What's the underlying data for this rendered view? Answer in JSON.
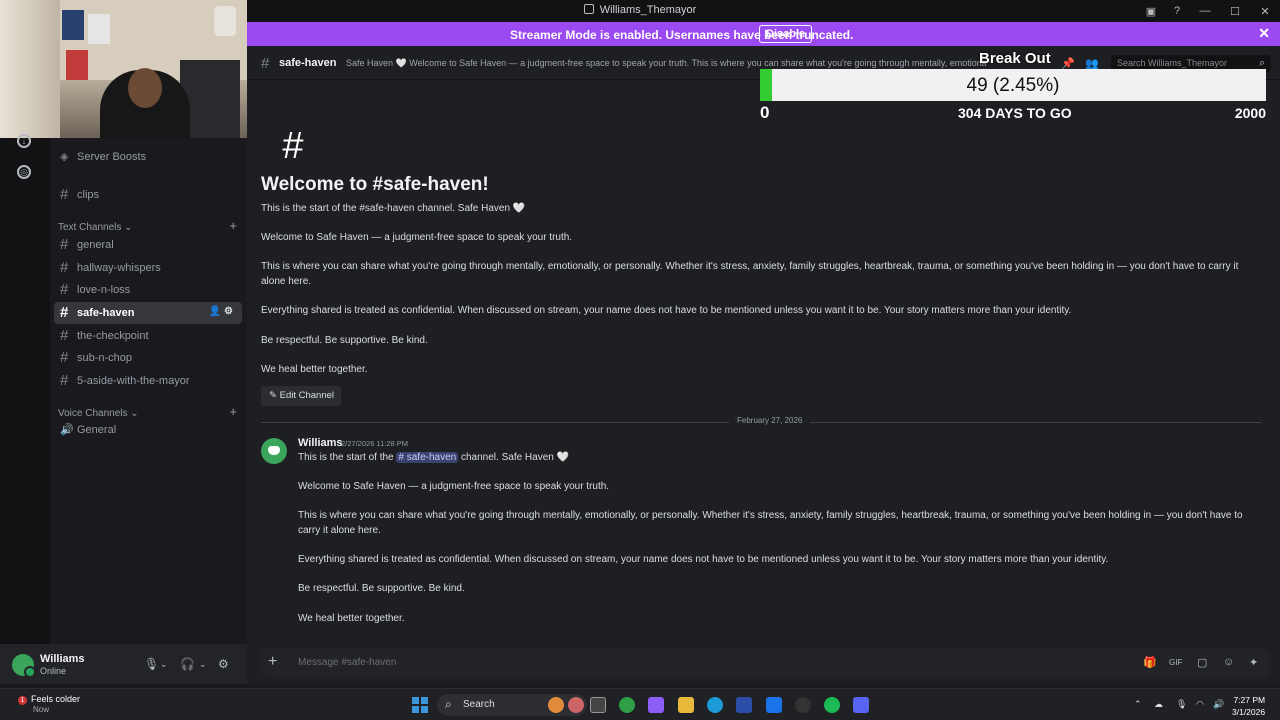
{
  "window": {
    "title": "Williams_Themayor"
  },
  "streamer_banner": {
    "text": "Streamer Mode is enabled. Usernames have been truncated.",
    "disable_label": "Disable",
    "close_icon": "close-icon",
    "color": "#9b49f1"
  },
  "sidebar": {
    "server_boosts": "Server Boosts",
    "top_items": [
      {
        "label": "clips"
      }
    ],
    "text_category": "Text Channels",
    "text_channels": [
      {
        "label": "general"
      },
      {
        "label": "hallway-whispers"
      },
      {
        "label": "love-n-loss"
      },
      {
        "label": "safe-haven",
        "active": true
      },
      {
        "label": "the-checkpoint"
      },
      {
        "label": "sub-n-chop"
      },
      {
        "label": "5-aside-with-the-mayor"
      }
    ],
    "voice_category": "Voice Channels",
    "voice_channels": [
      {
        "label": "General"
      }
    ]
  },
  "user": {
    "name": "Williams",
    "status": "Online"
  },
  "channel": {
    "name": "safe-haven",
    "topic": "Safe Haven 🤍 Welcome to Safe Haven — a judgment-free space to speak your truth. This is where you can share what you're going through mentally, emotionally,",
    "search_placeholder": "Search Williams_Themayor"
  },
  "overlay": {
    "title": "Break Out",
    "current_label": "49 (2.45%)",
    "progress_fraction": 0.0245,
    "min_label": "0",
    "max_label": "2000",
    "days_label": "304 DAYS TO GO",
    "fill_color": "#33cc33"
  },
  "welcome": {
    "title": "Welcome to #safe-haven!",
    "paragraphs": [
      "This is the start of the #safe-haven channel. Safe Haven 🤍",
      "Welcome to Safe Haven — a judgment-free space to speak your truth.",
      "This is where you can share what you're going through mentally, emotionally, or personally. Whether it's stress, anxiety, family struggles, heartbreak, trauma, or something you've been holding in — you don't have to carry it alone here.",
      "Everything shared is treated as confidential. When discussed on stream, your name does not have to be mentioned unless you want it to be. Your story matters more than your identity.",
      "Be respectful. Be supportive. Be kind.",
      "We heal better together."
    ],
    "edit_label": "Edit Channel"
  },
  "divider_date": "February 27, 2026",
  "message": {
    "author": "Williams",
    "timestamp": "2/27/2026 11:28 PM",
    "first_line_pre": "This is the start of the",
    "mention": "# safe-haven",
    "first_line_post": "channel. Safe Haven 🤍",
    "paragraphs": [
      "Welcome to Safe Haven — a judgment-free space to speak your truth.",
      "This is where you can share what you're going through mentally, emotionally, or personally. Whether it's stress, anxiety, family struggles, heartbreak, trauma, or something you've been holding in — you don't have to carry it alone here.",
      "Everything shared is treated as confidential. When discussed on stream, your name does not have to be mentioned unless you want it to be. Your story matters more than your identity.",
      "Be respectful. Be supportive. Be kind.",
      "We heal better together."
    ]
  },
  "composer": {
    "placeholder": "Message #safe-haven"
  },
  "taskbar": {
    "weather": "Feels colder",
    "weather_sub": "Now",
    "search": "Search",
    "time": "7:27 PM",
    "date": "3/1/2026"
  }
}
